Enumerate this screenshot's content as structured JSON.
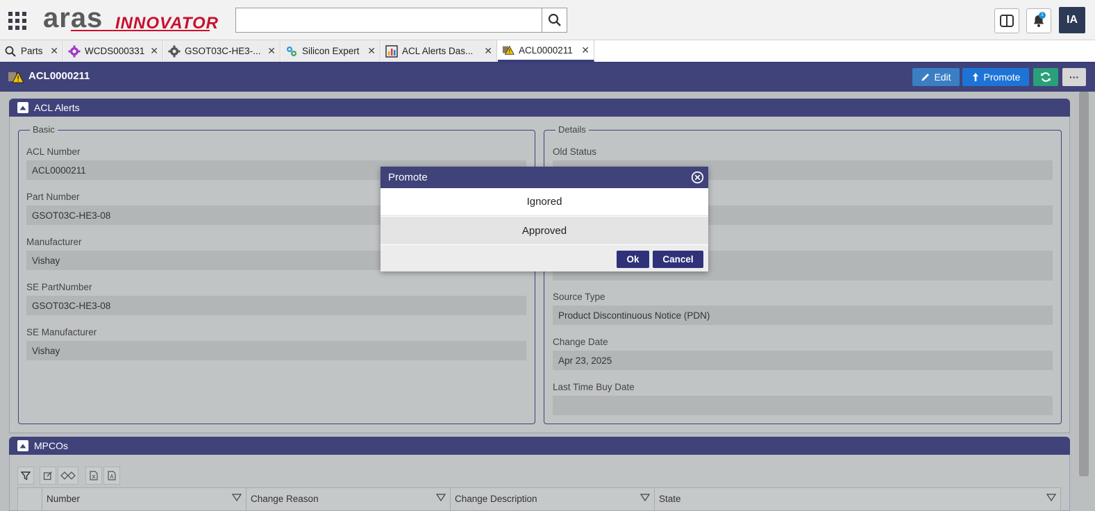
{
  "header": {
    "logo_primary": "aras",
    "logo_secondary": "INNOVATOR",
    "search_value": "",
    "avatar_initials": "IA",
    "notification_count": "1"
  },
  "tabs": [
    {
      "label": "Parts",
      "icon": "search-icon"
    },
    {
      "label": "WCDS000331",
      "icon": "gear-icon"
    },
    {
      "label": "GSOT03C-HE3-...",
      "icon": "gear-icon"
    },
    {
      "label": "Silicon Expert",
      "icon": "gears-icon"
    },
    {
      "label": "ACL Alerts Das...",
      "icon": "chart-icon"
    },
    {
      "label": "ACL0000211",
      "icon": "warning-icon"
    }
  ],
  "item": {
    "title": "ACL0000211",
    "edit_label": "Edit",
    "promote_label": "Promote",
    "more_label": "···"
  },
  "acl_section": {
    "title": "ACL Alerts",
    "basic": {
      "legend": "Basic",
      "fields": [
        {
          "label": "ACL Number",
          "value": "ACL0000211"
        },
        {
          "label": "Part Number",
          "value": "GSOT03C-HE3-08"
        },
        {
          "label": "Manufacturer",
          "value": "Vishay"
        },
        {
          "label": "SE PartNumber",
          "value": "GSOT03C-HE3-08"
        },
        {
          "label": "SE Manufacturer",
          "value": "Vishay"
        }
      ]
    },
    "details": {
      "legend": "Details",
      "fields": [
        {
          "label": "Old Status",
          "value": ""
        },
        {
          "label": "Source Type",
          "value": "Product Discontinuous Notice (PDN)"
        },
        {
          "label": "Change Date",
          "value": "Apr 23, 2025"
        },
        {
          "label": "Last Time Buy Date",
          "value": ""
        }
      ]
    }
  },
  "mpco_section": {
    "title": "MPCOs",
    "columns": [
      "Number",
      "Change Reason",
      "Change Description",
      "State"
    ]
  },
  "modal": {
    "title": "Promote",
    "options": [
      "Ignored",
      "Approved"
    ],
    "ok_label": "Ok",
    "cancel_label": "Cancel"
  },
  "colors": {
    "brand_navy": "#40427a",
    "brand_red": "#c8102e",
    "edit_blue": "#3a7fc3",
    "promote_blue": "#1e74d6",
    "refresh_green": "#29a07a"
  }
}
